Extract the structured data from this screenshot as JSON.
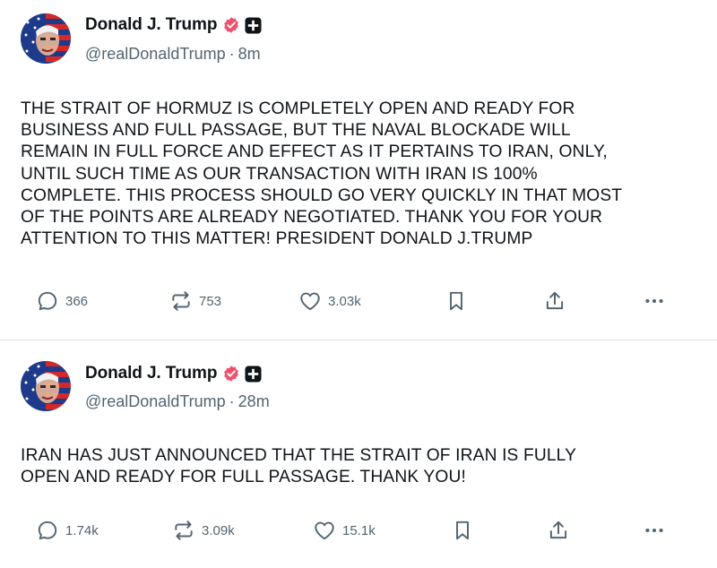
{
  "posts": [
    {
      "author": {
        "display_name": "Donald J. Trump",
        "handle": "@realDonaldTrump",
        "verified": true
      },
      "separator": "·",
      "timestamp": "8m",
      "text": "THE STRAIT OF HORMUZ IS COMPLETELY OPEN AND READY FOR\nBUSINESS AND FULL PASSAGE, BUT THE NAVAL BLOCKADE WILL\nREMAIN IN FULL FORCE AND EFFECT AS IT PERTAINS TO IRAN, ONLY,\nUNTIL SUCH TIME AS OUR TRANSACTION WITH IRAN IS 100%\nCOMPLETE. THIS PROCESS SHOULD GO VERY QUICKLY IN THAT MOST\nOF THE POINTS ARE ALREADY NEGOTIATED. THANK YOU FOR YOUR\nATTENTION TO THIS MATTER! PRESIDENT DONALD J.TRUMP",
      "stats": {
        "replies": "366",
        "reposts": "753",
        "likes": "3.03k"
      }
    },
    {
      "author": {
        "display_name": "Donald J. Trump",
        "handle": "@realDonaldTrump",
        "verified": true
      },
      "separator": "·",
      "timestamp": "28m",
      "text": "IRAN HAS JUST ANNOUNCED THAT THE STRAIT OF IRAN IS FULLY\nOPEN AND READY FOR FULL PASSAGE. THANK YOU!",
      "stats": {
        "replies": "1.74k",
        "reposts": "3.09k",
        "likes": "15.1k"
      }
    }
  ],
  "icons": {
    "verified": "verified-badge-icon",
    "plus": "plus-badge-icon",
    "reply": "reply-icon",
    "repost": "repost-icon",
    "like": "heart-icon",
    "bookmark": "bookmark-icon",
    "share": "share-icon",
    "more": "more-icon"
  },
  "colors": {
    "text": "#0f1419",
    "secondary": "#536471",
    "verified_badge": "#f0506e",
    "divider": "#dfe3e8"
  }
}
